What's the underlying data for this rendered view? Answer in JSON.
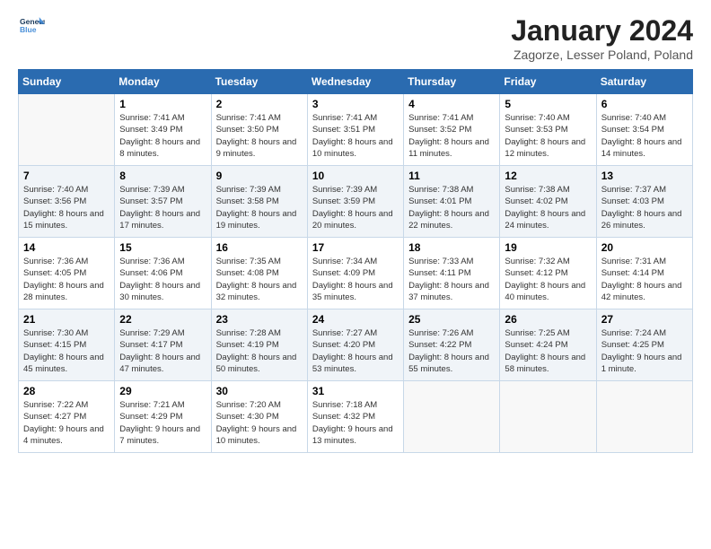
{
  "header": {
    "logo_line1": "General",
    "logo_line2": "Blue",
    "title": "January 2024",
    "location": "Zagorze, Lesser Poland, Poland"
  },
  "weekdays": [
    "Sunday",
    "Monday",
    "Tuesday",
    "Wednesday",
    "Thursday",
    "Friday",
    "Saturday"
  ],
  "weeks": [
    [
      {
        "day": "",
        "sunrise": "",
        "sunset": "",
        "daylight": ""
      },
      {
        "day": "1",
        "sunrise": "Sunrise: 7:41 AM",
        "sunset": "Sunset: 3:49 PM",
        "daylight": "Daylight: 8 hours and 8 minutes."
      },
      {
        "day": "2",
        "sunrise": "Sunrise: 7:41 AM",
        "sunset": "Sunset: 3:50 PM",
        "daylight": "Daylight: 8 hours and 9 minutes."
      },
      {
        "day": "3",
        "sunrise": "Sunrise: 7:41 AM",
        "sunset": "Sunset: 3:51 PM",
        "daylight": "Daylight: 8 hours and 10 minutes."
      },
      {
        "day": "4",
        "sunrise": "Sunrise: 7:41 AM",
        "sunset": "Sunset: 3:52 PM",
        "daylight": "Daylight: 8 hours and 11 minutes."
      },
      {
        "day": "5",
        "sunrise": "Sunrise: 7:40 AM",
        "sunset": "Sunset: 3:53 PM",
        "daylight": "Daylight: 8 hours and 12 minutes."
      },
      {
        "day": "6",
        "sunrise": "Sunrise: 7:40 AM",
        "sunset": "Sunset: 3:54 PM",
        "daylight": "Daylight: 8 hours and 14 minutes."
      }
    ],
    [
      {
        "day": "7",
        "sunrise": "Sunrise: 7:40 AM",
        "sunset": "Sunset: 3:56 PM",
        "daylight": "Daylight: 8 hours and 15 minutes."
      },
      {
        "day": "8",
        "sunrise": "Sunrise: 7:39 AM",
        "sunset": "Sunset: 3:57 PM",
        "daylight": "Daylight: 8 hours and 17 minutes."
      },
      {
        "day": "9",
        "sunrise": "Sunrise: 7:39 AM",
        "sunset": "Sunset: 3:58 PM",
        "daylight": "Daylight: 8 hours and 19 minutes."
      },
      {
        "day": "10",
        "sunrise": "Sunrise: 7:39 AM",
        "sunset": "Sunset: 3:59 PM",
        "daylight": "Daylight: 8 hours and 20 minutes."
      },
      {
        "day": "11",
        "sunrise": "Sunrise: 7:38 AM",
        "sunset": "Sunset: 4:01 PM",
        "daylight": "Daylight: 8 hours and 22 minutes."
      },
      {
        "day": "12",
        "sunrise": "Sunrise: 7:38 AM",
        "sunset": "Sunset: 4:02 PM",
        "daylight": "Daylight: 8 hours and 24 minutes."
      },
      {
        "day": "13",
        "sunrise": "Sunrise: 7:37 AM",
        "sunset": "Sunset: 4:03 PM",
        "daylight": "Daylight: 8 hours and 26 minutes."
      }
    ],
    [
      {
        "day": "14",
        "sunrise": "Sunrise: 7:36 AM",
        "sunset": "Sunset: 4:05 PM",
        "daylight": "Daylight: 8 hours and 28 minutes."
      },
      {
        "day": "15",
        "sunrise": "Sunrise: 7:36 AM",
        "sunset": "Sunset: 4:06 PM",
        "daylight": "Daylight: 8 hours and 30 minutes."
      },
      {
        "day": "16",
        "sunrise": "Sunrise: 7:35 AM",
        "sunset": "Sunset: 4:08 PM",
        "daylight": "Daylight: 8 hours and 32 minutes."
      },
      {
        "day": "17",
        "sunrise": "Sunrise: 7:34 AM",
        "sunset": "Sunset: 4:09 PM",
        "daylight": "Daylight: 8 hours and 35 minutes."
      },
      {
        "day": "18",
        "sunrise": "Sunrise: 7:33 AM",
        "sunset": "Sunset: 4:11 PM",
        "daylight": "Daylight: 8 hours and 37 minutes."
      },
      {
        "day": "19",
        "sunrise": "Sunrise: 7:32 AM",
        "sunset": "Sunset: 4:12 PM",
        "daylight": "Daylight: 8 hours and 40 minutes."
      },
      {
        "day": "20",
        "sunrise": "Sunrise: 7:31 AM",
        "sunset": "Sunset: 4:14 PM",
        "daylight": "Daylight: 8 hours and 42 minutes."
      }
    ],
    [
      {
        "day": "21",
        "sunrise": "Sunrise: 7:30 AM",
        "sunset": "Sunset: 4:15 PM",
        "daylight": "Daylight: 8 hours and 45 minutes."
      },
      {
        "day": "22",
        "sunrise": "Sunrise: 7:29 AM",
        "sunset": "Sunset: 4:17 PM",
        "daylight": "Daylight: 8 hours and 47 minutes."
      },
      {
        "day": "23",
        "sunrise": "Sunrise: 7:28 AM",
        "sunset": "Sunset: 4:19 PM",
        "daylight": "Daylight: 8 hours and 50 minutes."
      },
      {
        "day": "24",
        "sunrise": "Sunrise: 7:27 AM",
        "sunset": "Sunset: 4:20 PM",
        "daylight": "Daylight: 8 hours and 53 minutes."
      },
      {
        "day": "25",
        "sunrise": "Sunrise: 7:26 AM",
        "sunset": "Sunset: 4:22 PM",
        "daylight": "Daylight: 8 hours and 55 minutes."
      },
      {
        "day": "26",
        "sunrise": "Sunrise: 7:25 AM",
        "sunset": "Sunset: 4:24 PM",
        "daylight": "Daylight: 8 hours and 58 minutes."
      },
      {
        "day": "27",
        "sunrise": "Sunrise: 7:24 AM",
        "sunset": "Sunset: 4:25 PM",
        "daylight": "Daylight: 9 hours and 1 minute."
      }
    ],
    [
      {
        "day": "28",
        "sunrise": "Sunrise: 7:22 AM",
        "sunset": "Sunset: 4:27 PM",
        "daylight": "Daylight: 9 hours and 4 minutes."
      },
      {
        "day": "29",
        "sunrise": "Sunrise: 7:21 AM",
        "sunset": "Sunset: 4:29 PM",
        "daylight": "Daylight: 9 hours and 7 minutes."
      },
      {
        "day": "30",
        "sunrise": "Sunrise: 7:20 AM",
        "sunset": "Sunset: 4:30 PM",
        "daylight": "Daylight: 9 hours and 10 minutes."
      },
      {
        "day": "31",
        "sunrise": "Sunrise: 7:18 AM",
        "sunset": "Sunset: 4:32 PM",
        "daylight": "Daylight: 9 hours and 13 minutes."
      },
      {
        "day": "",
        "sunrise": "",
        "sunset": "",
        "daylight": ""
      },
      {
        "day": "",
        "sunrise": "",
        "sunset": "",
        "daylight": ""
      },
      {
        "day": "",
        "sunrise": "",
        "sunset": "",
        "daylight": ""
      }
    ]
  ]
}
